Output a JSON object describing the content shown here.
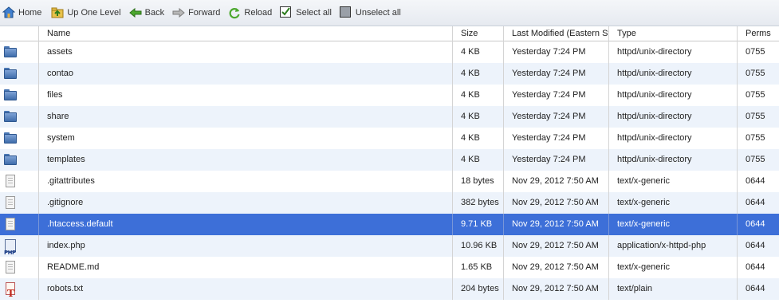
{
  "toolbar": {
    "home": "Home",
    "up_one_level": "Up One Level",
    "back": "Back",
    "forward": "Forward",
    "reload": "Reload",
    "select_all": "Select all",
    "unselect_all": "Unselect all"
  },
  "columns": {
    "name": "Name",
    "size": "Size",
    "modified": "Last Modified (Eastern St",
    "type": "Type",
    "perms": "Perms"
  },
  "files": [
    {
      "icon": "folder-icon",
      "name": "assets",
      "size": "4 KB",
      "modified": "Yesterday 7:24 PM",
      "type": "httpd/unix-directory",
      "perms": "0755"
    },
    {
      "icon": "folder-icon",
      "name": "contao",
      "size": "4 KB",
      "modified": "Yesterday 7:24 PM",
      "type": "httpd/unix-directory",
      "perms": "0755"
    },
    {
      "icon": "folder-icon",
      "name": "files",
      "size": "4 KB",
      "modified": "Yesterday 7:24 PM",
      "type": "httpd/unix-directory",
      "perms": "0755"
    },
    {
      "icon": "folder-icon",
      "name": "share",
      "size": "4 KB",
      "modified": "Yesterday 7:24 PM",
      "type": "httpd/unix-directory",
      "perms": "0755"
    },
    {
      "icon": "folder-icon",
      "name": "system",
      "size": "4 KB",
      "modified": "Yesterday 7:24 PM",
      "type": "httpd/unix-directory",
      "perms": "0755"
    },
    {
      "icon": "folder-icon",
      "name": "templates",
      "size": "4 KB",
      "modified": "Yesterday 7:24 PM",
      "type": "httpd/unix-directory",
      "perms": "0755"
    },
    {
      "icon": "generic-file-icon",
      "name": ".gitattributes",
      "size": "18 bytes",
      "modified": "Nov 29, 2012 7:50 AM",
      "type": "text/x-generic",
      "perms": "0644"
    },
    {
      "icon": "generic-file-icon",
      "name": ".gitignore",
      "size": "382 bytes",
      "modified": "Nov 29, 2012 7:50 AM",
      "type": "text/x-generic",
      "perms": "0644"
    },
    {
      "icon": "generic-file-icon",
      "name": ".htaccess.default",
      "size": "9.71 KB",
      "modified": "Nov 29, 2012 7:50 AM",
      "type": "text/x-generic",
      "perms": "0644",
      "selected": true
    },
    {
      "icon": "php-file-icon",
      "name": "index.php",
      "size": "10.96 KB",
      "modified": "Nov 29, 2012 7:50 AM",
      "type": "application/x-httpd-php",
      "perms": "0644"
    },
    {
      "icon": "generic-file-icon",
      "name": "README.md",
      "size": "1.65 KB",
      "modified": "Nov 29, 2012 7:50 AM",
      "type": "text/x-generic",
      "perms": "0644"
    },
    {
      "icon": "text-file-icon",
      "name": "robots.txt",
      "size": "204 bytes",
      "modified": "Nov 29, 2012 7:50 AM",
      "type": "text/plain",
      "perms": "0644"
    }
  ],
  "colors": {
    "selected_row": "#3d6fd8",
    "alt_row": "#edf3fb",
    "toolbar_bg": "#e6eaf0"
  }
}
